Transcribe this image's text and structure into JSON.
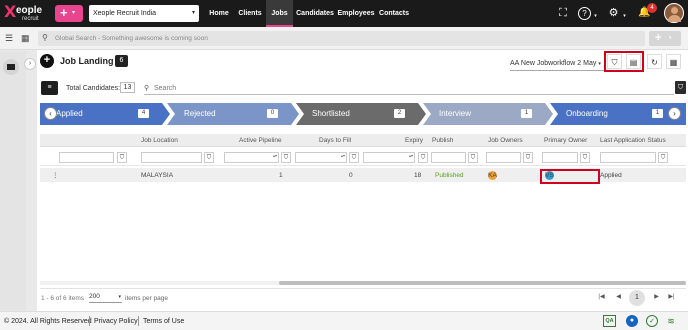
{
  "topbar": {
    "logo_mark": "X",
    "logo_brand": "eople",
    "logo_sub": "recruit",
    "plus_label": "+",
    "plus_caret": "▾",
    "company": "Xeople Recruit India",
    "company_caret": "▾",
    "nav": [
      "Home",
      "Clients",
      "Jobs",
      "Candidates",
      "Employees",
      "Contacts"
    ],
    "active_nav": "Jobs",
    "icons": {
      "fullscreen": "⛶",
      "help": "?",
      "settings": "⚙",
      "bell": "🔔"
    },
    "help_caret": "▾",
    "settings_caret": "▾",
    "notification_count": "4",
    "accent_color": "#e8458f"
  },
  "search": {
    "placeholder": "Global Search - Something awesome is coming soon",
    "add_label": "+",
    "add_caret": "▾"
  },
  "page": {
    "title": "Job Landing",
    "count": "6",
    "workflow": "AA New Jobworkflow 2 May",
    "workflow_caret": "▾",
    "total_label": "Total Candidates:",
    "total_value": "13",
    "candidate_search_placeholder": "Search"
  },
  "stages": [
    {
      "label": "Applied",
      "count": "4",
      "color": "#4a72c4"
    },
    {
      "label": "Rejected",
      "count": "0",
      "color": "#7c95c9"
    },
    {
      "label": "Shortlisted",
      "count": "2",
      "color": "#6b6b6b"
    },
    {
      "label": "Interview",
      "count": "1",
      "color": "#9ba9c5"
    },
    {
      "label": "Onboarding",
      "count": "1",
      "color": "#4a72c4"
    }
  ],
  "grid": {
    "columns": [
      "Job Location",
      "Active Pipeline",
      "Days to Fill",
      "Expiry",
      "Publish",
      "Job Owners",
      "Primary Owner",
      "Last Application Status"
    ],
    "row": {
      "location": "MALAYSIA",
      "active_pipeline": "1",
      "days_to_fill": "0",
      "expiry": "18",
      "publish": "Published",
      "job_owner_initials": "KA",
      "primary_owner_initials": "VS",
      "last_status": "Applied"
    }
  },
  "pager": {
    "info": "1 - 6 of 6 items",
    "page_size": "200",
    "page_size_caret": "▾",
    "per_page_label": "items per page",
    "current_page": "1",
    "nav": {
      "first": "|◀",
      "prev": "◀",
      "next": "▶",
      "last": "▶|"
    }
  },
  "footer": {
    "copyright": "© 2024. All Rights Reserved",
    "privacy": "Privacy Policy",
    "terms": "Terms of Use",
    "qa_badge": "QA"
  }
}
